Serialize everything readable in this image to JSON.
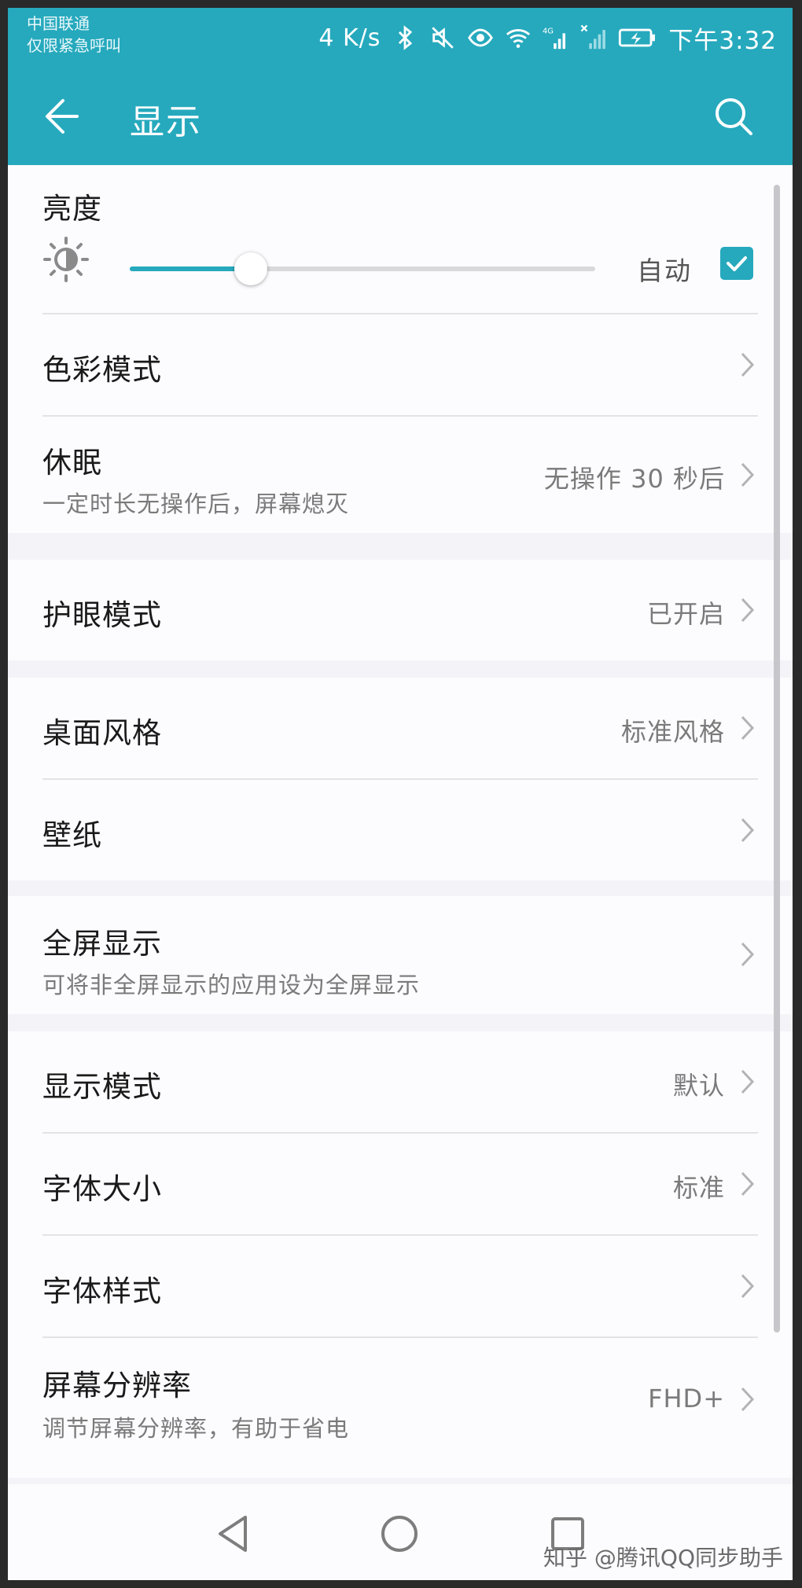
{
  "status_bar": {
    "carrier_line1": "中国联通",
    "carrier_line2": "仅限紧急呼叫",
    "net_speed": "4 K/s",
    "time": "下午3:32",
    "icons": [
      "bluetooth-icon",
      "mute-icon",
      "eye-comfort-icon",
      "wifi-icon",
      "4g-signal-icon",
      "no-signal-icon",
      "battery-charging-icon"
    ]
  },
  "app_bar": {
    "title": "显示",
    "back_icon": "back-arrow-icon",
    "search_icon": "search-icon"
  },
  "brightness": {
    "label": "亮度",
    "level": 0.26,
    "auto_label": "自动",
    "auto_checked": true
  },
  "settings": {
    "color_mode": {
      "label": "色彩模式"
    },
    "sleep": {
      "label": "休眠",
      "sub": "一定时长无操作后，屏幕熄灭",
      "value": "无操作 30 秒后"
    },
    "eye_comfort": {
      "label": "护眼模式",
      "value": "已开启"
    },
    "home_style": {
      "label": "桌面风格",
      "value": "标准风格"
    },
    "wallpaper": {
      "label": "壁纸"
    },
    "full_screen": {
      "label": "全屏显示",
      "sub": "可将非全屏显示的应用设为全屏显示"
    },
    "display_mode": {
      "label": "显示模式",
      "value": "默认"
    },
    "font_size": {
      "label": "字体大小",
      "value": "标准"
    },
    "font_style": {
      "label": "字体样式"
    },
    "resolution": {
      "label": "屏幕分辨率",
      "sub": "调节屏幕分辨率，有助于省电",
      "value": "FHD+"
    }
  },
  "nav_bar": {
    "icons": [
      "nav-back-icon",
      "nav-home-icon",
      "nav-recents-icon"
    ]
  },
  "watermark": "知乎 @腾讯QQ同步助手",
  "colors": {
    "accent": "#26a9bd",
    "page_bg": "#f4f3f7",
    "card_bg": "#fcfbfd"
  }
}
